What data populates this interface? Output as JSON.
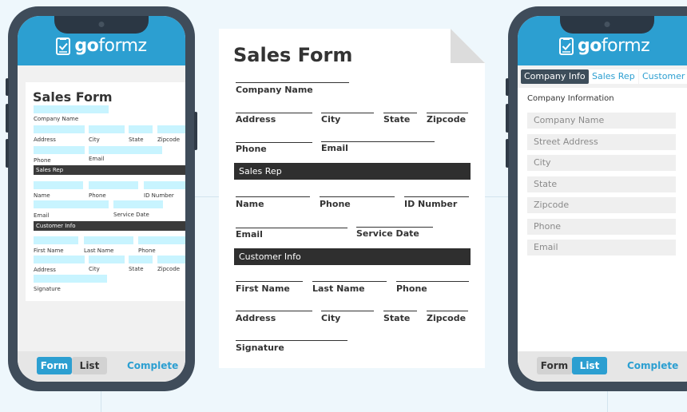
{
  "brand": {
    "name_bold": "go",
    "name_light": "formz",
    "primary_color": "#2c9fd1",
    "dark_color": "#3f4c5a"
  },
  "left_phone": {
    "form_title": "Sales Form",
    "labels": {
      "company_name": "Company Name",
      "address": "Address",
      "city": "City",
      "state": "State",
      "zipcode": "Zipcode",
      "phone": "Phone",
      "email": "Email",
      "name": "Name",
      "phone2": "Phone",
      "id_number": "ID Number",
      "email2": "Email",
      "service_date": "Service Date",
      "first_name": "First Name",
      "last_name": "Last Name",
      "phone3": "Phone",
      "address2": "Address",
      "city2": "City",
      "state2": "State",
      "zipcode2": "Zipcode",
      "signature": "Signature"
    },
    "sections": {
      "sales_rep": "Sales Rep",
      "customer_info": "Customer Info"
    },
    "bottom": {
      "form": "Form",
      "list": "List",
      "complete": "Complete",
      "active": "form"
    }
  },
  "paper": {
    "title": "Sales Form",
    "labels": {
      "company_name": "Company Name",
      "address": "Address",
      "city": "City",
      "state": "State",
      "zipcode": "Zipcode",
      "phone": "Phone",
      "email": "Email",
      "name": "Name",
      "phone2": "Phone",
      "id_number": "ID Number",
      "email2": "Email",
      "service_date": "Service Date",
      "first_name": "First Name",
      "last_name": "Last Name",
      "phone3": "Phone",
      "address2": "Address",
      "city2": "City",
      "state2": "State",
      "zipcode2": "Zipcode",
      "signature": "Signature"
    },
    "sections": {
      "sales_rep": "Sales Rep",
      "customer_info": "Customer Info"
    }
  },
  "right_phone": {
    "tabs": [
      "Company Info",
      "Sales Rep",
      "Customer I"
    ],
    "active_tab": 0,
    "section_title": "Company Information",
    "fields": [
      "Company Name",
      "Street Address",
      "City",
      "State",
      "Zipcode",
      "Phone",
      "Email"
    ],
    "bottom": {
      "form": "Form",
      "list": "List",
      "complete": "Complete",
      "active": "list"
    }
  }
}
